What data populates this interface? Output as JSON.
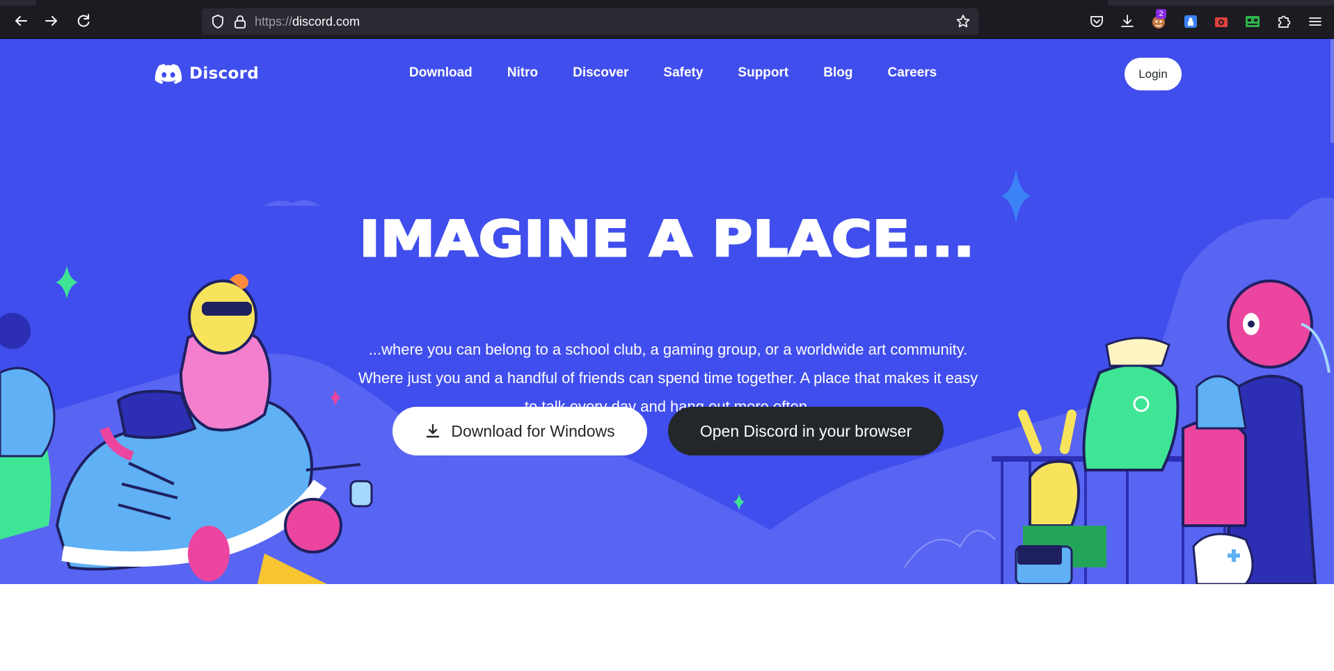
{
  "browser": {
    "url_scheme": "https://",
    "url_host": "discord.com",
    "extension_badge": "2",
    "icons": [
      "back-arrow-icon",
      "forward-arrow-icon",
      "reload-icon",
      "shield-icon",
      "lock-icon",
      "bookmark-star-icon",
      "pocket-icon",
      "download-icon",
      "extension-avatar-icon",
      "extension-blue-icon",
      "extension-camera-icon",
      "extension-green-icon",
      "extensions-puzzle-icon",
      "menu-hamburger-icon"
    ]
  },
  "site": {
    "brand": "Discord",
    "nav": [
      "Download",
      "Nitro",
      "Discover",
      "Safety",
      "Support",
      "Blog",
      "Careers"
    ],
    "login_label": "Login"
  },
  "hero": {
    "headline": "IMAGINE A PLACE...",
    "subtitle_lines": [
      "...where you can belong to a school club, a gaming group, or a worldwide art community.",
      "Where just you and a handful of friends can spend time together. A place that makes it easy",
      "to talk every day and hang out more often."
    ],
    "download_label": "Download for Windows",
    "browser_label": "Open Discord in your browser"
  },
  "colors": {
    "blurple": "#404eed",
    "hill": "#5865f2",
    "dark_button": "#23272a",
    "chrome": "#1c1b22"
  }
}
